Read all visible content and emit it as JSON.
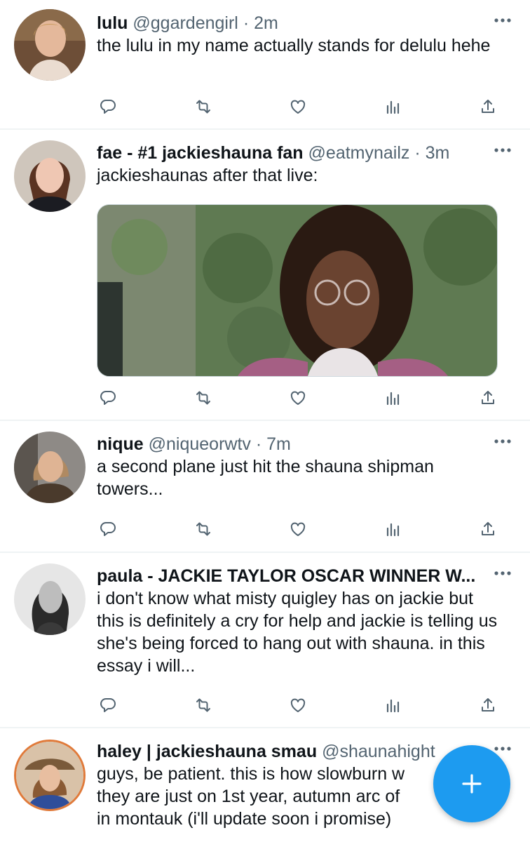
{
  "colors": {
    "accent": "#1d9bf0",
    "icon": "#536471",
    "divider": "#eff3f4"
  },
  "tweets": [
    {
      "name": "lulu",
      "handle": "@ggardengirl",
      "dot": "·",
      "time": "2m",
      "text": "the lulu in my name actually stands for delulu hehe"
    },
    {
      "name": "fae - #1 jackieshauna fan",
      "handle": "@eatmynailz",
      "dot": "·",
      "time": "3m",
      "text": "jackieshaunas after that live:",
      "has_media": true
    },
    {
      "name": "nique",
      "handle": "@niqueorwtv",
      "dot": "·",
      "time": "7m",
      "text": "a second plane just hit the shauna shipman towers..."
    },
    {
      "name": "paula - JACKIE TAYLOR OSCAR WINNER W...",
      "handle": "",
      "dot": "",
      "time": "",
      "text": "i don't know what misty quigley has on jackie but this is definitely a cry for help and jackie is telling us she's being forced to hang out with shauna. in this essay i will..."
    },
    {
      "name": "haley | jackieshauna smau",
      "handle": "@shaunahight",
      "dot": "",
      "time": "",
      "text": "guys, be patient. this is how slowburn w... they are just on 1st year, autumn arc of ... e in montauk (i'll update soon i promise)"
    }
  ],
  "tweet5_lines": [
    "guys, be patient. this is how slowburn w",
    "they are just on 1st year, autumn arc of",
    "in montauk (i'll update soon i promise)"
  ],
  "icons": [
    "reply-icon",
    "retweet-icon",
    "like-icon",
    "views-icon",
    "share-icon",
    "more-icon",
    "compose-plus-icon"
  ]
}
